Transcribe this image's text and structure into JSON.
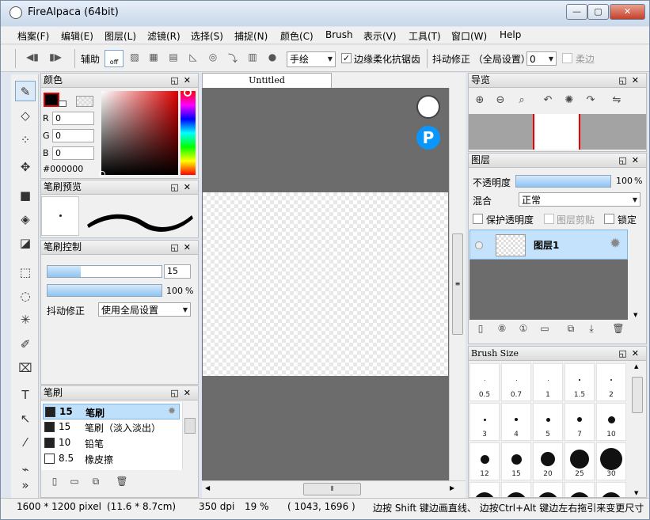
{
  "window": {
    "title": "FireAlpaca (64bit)",
    "buttons": {
      "minimize": "—",
      "maximize": "▢",
      "close": "✕"
    }
  },
  "menu": [
    "档案(F)",
    "编辑(E)",
    "图层(L)",
    "滤镜(R)",
    "选择(S)",
    "捕捉(N)",
    "颜色(C)",
    "Brush",
    "表示(V)",
    "工具(T)",
    "窗口(W)",
    "Help"
  ],
  "toolbar": {
    "snap_label": "辅助",
    "snap_off": "off",
    "brush_mode": "手绘",
    "antialias_label": "边缘柔化抗锯齿",
    "antialias_checked": true,
    "stabilizer_label": "抖动修正 （全局设置）",
    "stabilizer_value": "0",
    "soft_label": "柔边",
    "soft_checked": false
  },
  "tools": [
    {
      "icon": "pen-icon",
      "glyph": "✎"
    },
    {
      "icon": "eraser-icon",
      "glyph": "◇"
    },
    {
      "icon": "dot-tool-icon",
      "glyph": "⁘"
    },
    {
      "icon": "move-icon",
      "glyph": "✥"
    },
    {
      "icon": "fill-rect-icon",
      "glyph": "■"
    },
    {
      "icon": "bucket-icon",
      "glyph": "◈"
    },
    {
      "icon": "gradient-icon",
      "glyph": "◪"
    },
    {
      "icon": "select-rect-icon",
      "glyph": "⬚"
    },
    {
      "icon": "lasso-icon",
      "glyph": "◌"
    },
    {
      "icon": "magic-wand-icon",
      "glyph": "✳"
    },
    {
      "icon": "select-pen-icon",
      "glyph": "✐"
    },
    {
      "icon": "select-eraser-icon",
      "glyph": "⌧"
    },
    {
      "icon": "text-icon",
      "glyph": "T"
    },
    {
      "icon": "operation-icon",
      "glyph": "↖"
    },
    {
      "icon": "eyedropper-icon",
      "glyph": "⁄"
    },
    {
      "icon": "dropper-icon",
      "glyph": "⌁"
    },
    {
      "icon": "more-tools-icon",
      "glyph": "»"
    }
  ],
  "color_panel": {
    "title": "颜色",
    "r_label": "R",
    "g_label": "G",
    "b_label": "B",
    "r": "0",
    "g": "0",
    "b": "0",
    "hex": "#000000",
    "main_color": "#000000"
  },
  "brush_preview_panel": {
    "title": "笔刷预览"
  },
  "brush_control_panel": {
    "title": "笔刷控制",
    "size": "15",
    "opacity": "100",
    "opacity_unit": "%",
    "stabilizer_label": "抖动修正",
    "stabilizer_value": "使用全局设置",
    "size_fraction": 0.29,
    "opacity_fraction": 1.0
  },
  "brush_panel": {
    "title": "笔刷",
    "items": [
      {
        "size": "15",
        "name": "笔刷",
        "selected": true,
        "swatch": "#222222"
      },
      {
        "size": "15",
        "name": "笔刷（淡入淡出）",
        "selected": false,
        "swatch": "#222222"
      },
      {
        "size": "10",
        "name": "铅笔",
        "selected": false,
        "swatch": "#222222"
      },
      {
        "size": "8.5",
        "name": "橡皮擦",
        "selected": false,
        "swatch": "#ffffff"
      }
    ]
  },
  "canvas": {
    "tab_title": "Untitled",
    "pixiv_glyph": "P"
  },
  "navigator_panel": {
    "title": "导览"
  },
  "layer_panel": {
    "title": "图层",
    "opacity_label": "不透明度",
    "opacity": "100",
    "opacity_unit": "%",
    "blend_label": "混合",
    "blend_value": "正常",
    "protect_label": "保护透明度",
    "clip_label": "图层剪贴",
    "lock_label": "锁定",
    "layer_name": "图层1"
  },
  "brush_size_panel": {
    "title": "Brush Size",
    "sizes": [
      {
        "label": "0.5",
        "d": 1
      },
      {
        "label": "0.7",
        "d": 1
      },
      {
        "label": "1",
        "d": 1
      },
      {
        "label": "1.5",
        "d": 1.5
      },
      {
        "label": "2",
        "d": 2
      },
      {
        "label": "3",
        "d": 3
      },
      {
        "label": "4",
        "d": 4
      },
      {
        "label": "5",
        "d": 5
      },
      {
        "label": "7",
        "d": 6
      },
      {
        "label": "10",
        "d": 9
      },
      {
        "label": "12",
        "d": 11
      },
      {
        "label": "15",
        "d": 13
      },
      {
        "label": "20",
        "d": 18
      },
      {
        "label": "25",
        "d": 24
      },
      {
        "label": "30",
        "d": 28
      },
      {
        "label": "",
        "d": 26
      },
      {
        "label": "",
        "d": 26
      },
      {
        "label": "",
        "d": 26
      },
      {
        "label": "",
        "d": 26
      },
      {
        "label": "",
        "d": 26
      }
    ]
  },
  "status": {
    "size": "1600 * 1200 pixel",
    "cm": "(11.6 * 8.7cm)",
    "dpi": "350 dpi",
    "zoom": "19 %",
    "coords": "( 1043, 1696 )",
    "hint": "边按 Shift 键边画直线、 边按Ctrl+Alt 键边左右拖引来变更尺寸"
  }
}
